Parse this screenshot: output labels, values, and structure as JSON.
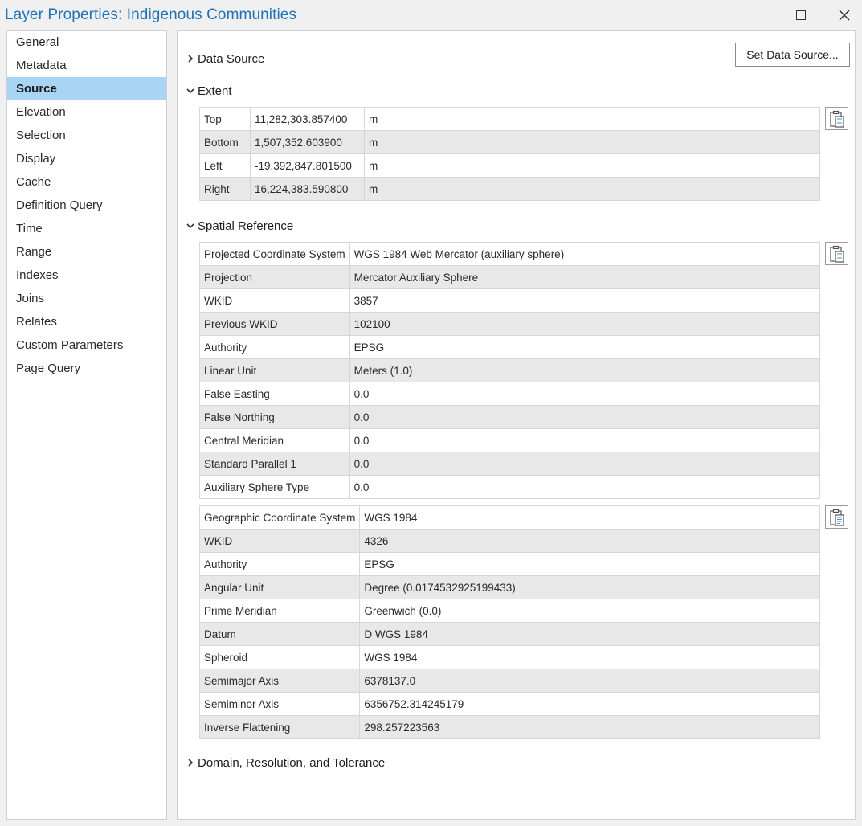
{
  "window": {
    "title": "Layer Properties: Indigenous Communities"
  },
  "sidebar": {
    "items": [
      {
        "label": "General"
      },
      {
        "label": "Metadata"
      },
      {
        "label": "Source"
      },
      {
        "label": "Elevation"
      },
      {
        "label": "Selection"
      },
      {
        "label": "Display"
      },
      {
        "label": "Cache"
      },
      {
        "label": "Definition Query"
      },
      {
        "label": "Time"
      },
      {
        "label": "Range"
      },
      {
        "label": "Indexes"
      },
      {
        "label": "Joins"
      },
      {
        "label": "Relates"
      },
      {
        "label": "Custom Parameters"
      },
      {
        "label": "Page Query"
      }
    ],
    "active": "Source"
  },
  "sections": {
    "data_source": {
      "label": "Data Source",
      "expanded": false,
      "button_label": "Set Data Source..."
    },
    "extent": {
      "label": "Extent",
      "expanded": true,
      "rows": [
        {
          "name": "Top",
          "value": "11,282,303.857400",
          "unit": "m"
        },
        {
          "name": "Bottom",
          "value": "1,507,352.603900",
          "unit": "m"
        },
        {
          "name": "Left",
          "value": "-19,392,847.801500",
          "unit": "m"
        },
        {
          "name": "Right",
          "value": "16,224,383.590800",
          "unit": "m"
        }
      ]
    },
    "spatial_reference": {
      "label": "Spatial Reference",
      "expanded": true,
      "projected": [
        {
          "name": "Projected Coordinate System",
          "value": "WGS 1984 Web Mercator (auxiliary sphere)"
        },
        {
          "name": "Projection",
          "value": "Mercator Auxiliary Sphere"
        },
        {
          "name": "WKID",
          "value": "3857"
        },
        {
          "name": "Previous WKID",
          "value": "102100"
        },
        {
          "name": "Authority",
          "value": "EPSG"
        },
        {
          "name": "Linear Unit",
          "value": "Meters (1.0)"
        },
        {
          "name": "False Easting",
          "value": "0.0"
        },
        {
          "name": "False Northing",
          "value": "0.0"
        },
        {
          "name": "Central Meridian",
          "value": "0.0"
        },
        {
          "name": "Standard Parallel 1",
          "value": "0.0"
        },
        {
          "name": "Auxiliary Sphere Type",
          "value": "0.0"
        }
      ],
      "geographic": [
        {
          "name": "Geographic Coordinate System",
          "value": "WGS 1984"
        },
        {
          "name": "WKID",
          "value": "4326"
        },
        {
          "name": "Authority",
          "value": "EPSG"
        },
        {
          "name": "Angular Unit",
          "value": "Degree (0.0174532925199433)"
        },
        {
          "name": "Prime Meridian",
          "value": "Greenwich (0.0)"
        },
        {
          "name": "Datum",
          "value": "D WGS 1984"
        },
        {
          "name": "Spheroid",
          "value": "WGS 1984"
        },
        {
          "name": "Semimajor Axis",
          "value": "6378137.0"
        },
        {
          "name": "Semiminor Axis",
          "value": "6356752.314245179"
        },
        {
          "name": "Inverse Flattening",
          "value": "298.257223563"
        }
      ]
    },
    "domain": {
      "label": "Domain, Resolution, and Tolerance",
      "expanded": false
    }
  },
  "colors": {
    "title": "#1f72b8",
    "active_nav": "#a9d5f5",
    "alt_row": "#e8e8e8"
  },
  "icons": {
    "copy": "copy-to-clipboard-icon",
    "maximize": "maximize-icon",
    "close": "close-icon"
  }
}
